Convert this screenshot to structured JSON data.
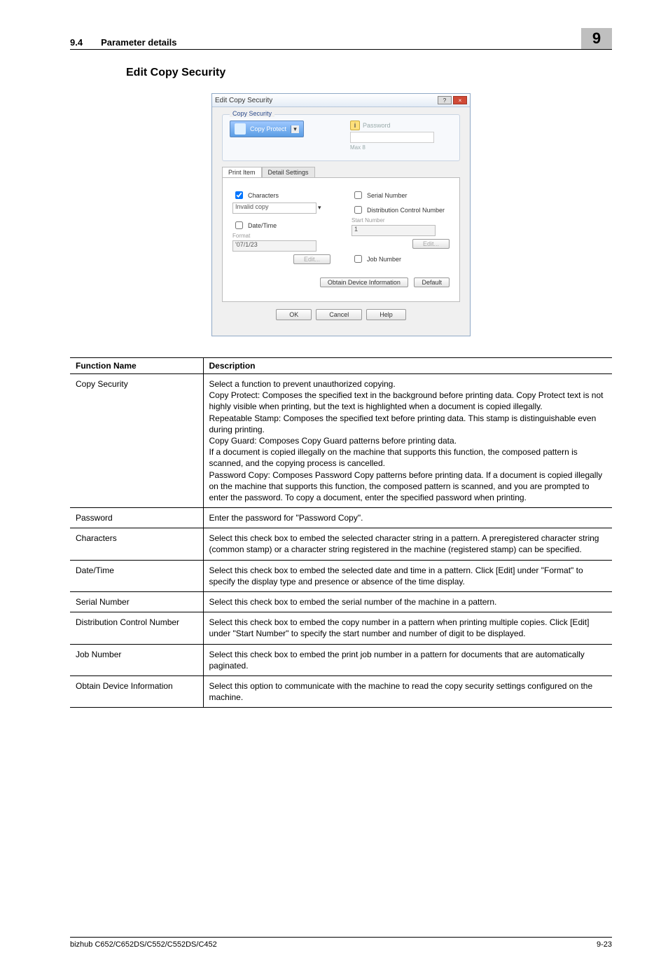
{
  "header": {
    "section_no": "9.4",
    "section_title": "Parameter details",
    "chapter": "9"
  },
  "heading": "Edit Copy Security",
  "dialog": {
    "title": "Edit Copy Security",
    "group_legend": "Copy Security",
    "combo_label": "Copy Protect",
    "password_label": "Password",
    "max_hint": "Max 8",
    "tab_active": "Print Item",
    "tab_inactive": "Detail Settings",
    "cb_characters": "Characters",
    "characters_value": "Invalid copy",
    "cb_datetime": "Date/Time",
    "datetime_sub": "Format",
    "datetime_value": "'07/1/23",
    "datetime_edit": "Edit...",
    "cb_serial": "Serial Number",
    "cb_distctrl": "Distribution Control Number",
    "startnum_label": "Start Number",
    "startnum_value": "1",
    "startnum_edit": "Edit...",
    "cb_jobnum": "Job Number",
    "btn_obtain": "Obtain Device Information",
    "btn_default": "Default",
    "btn_ok": "OK",
    "btn_cancel": "Cancel",
    "btn_help": "Help"
  },
  "table": {
    "head_fn": "Function Name",
    "head_desc": "Description",
    "rows": [
      {
        "fn": "Copy Security",
        "desc": "Select a function to prevent unauthorized copying.\nCopy Protect: Composes the specified text in the background before printing data. Copy Protect text is not highly visible when printing, but the text is highlighted when a document is copied illegally.\nRepeatable Stamp: Composes the specified text before printing data. This stamp is distinguishable even during printing.\nCopy Guard: Composes Copy Guard patterns before printing data.\nIf a document is copied illegally on the machine that supports this function, the composed pattern is scanned, and the copying process is cancelled.\nPassword Copy: Composes Password Copy patterns before printing data. If a document is copied illegally on the machine that supports this function, the composed pattern is scanned, and you are prompted to enter the password. To copy a document, enter the specified password when printing."
      },
      {
        "fn": "Password",
        "desc": "Enter the password for \"Password Copy\"."
      },
      {
        "fn": "Characters",
        "desc": "Select this check box to embed the selected character string in a pattern. A preregistered character string (common stamp) or a character string registered in the machine (registered stamp) can be specified."
      },
      {
        "fn": "Date/Time",
        "desc": "Select this check box to embed the selected date and time in a pattern. Click [Edit] under \"Format\" to specify the display type and presence or absence of the time display."
      },
      {
        "fn": "Serial Number",
        "desc": "Select this check box to embed the serial number of the machine in a pattern."
      },
      {
        "fn": "Distribution Control Number",
        "desc": "Select this check box to embed the copy number in a pattern when printing multiple copies. Click [Edit] under \"Start Number\" to specify the start number and number of digit to be displayed."
      },
      {
        "fn": "Job Number",
        "desc": "Select this check box to embed the print job number in a pattern for documents that are automatically paginated."
      },
      {
        "fn": "Obtain Device Information",
        "desc": "Select this option to communicate with the machine to read the copy security settings configured on the machine."
      }
    ]
  },
  "footer": {
    "model": "bizhub C652/C652DS/C552/C552DS/C452",
    "page": "9-23"
  }
}
